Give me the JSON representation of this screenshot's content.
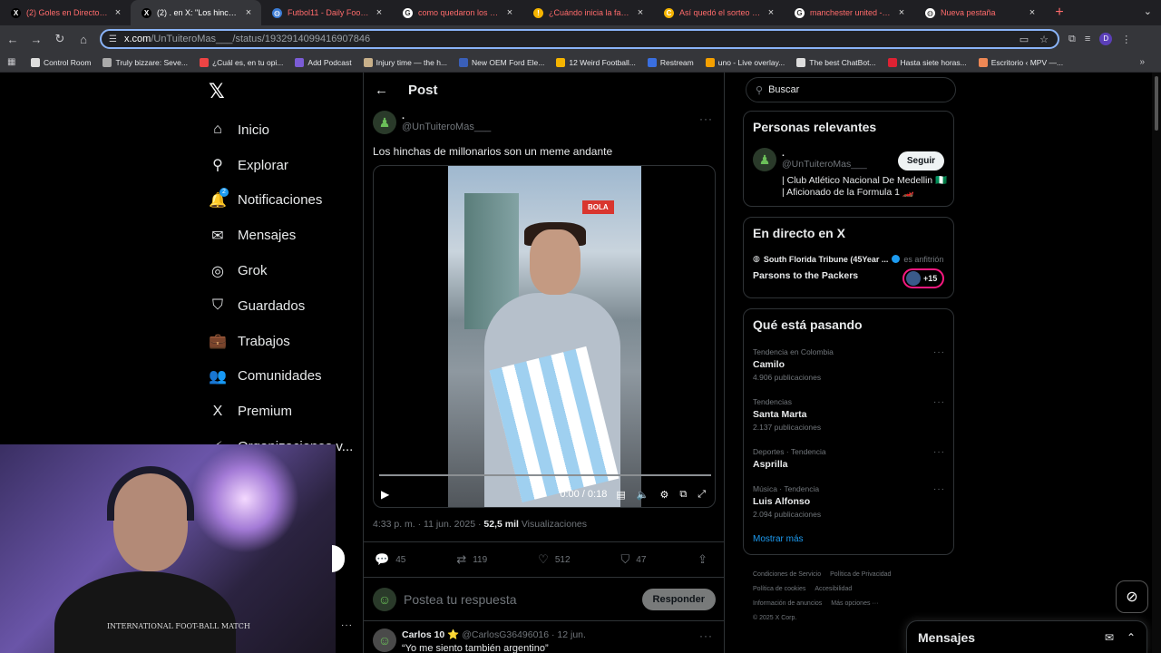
{
  "browser": {
    "tabs": [
      {
        "title": "(2) Goles en Directo (@y...",
        "fav_color": "#000",
        "fav_glyph": "X"
      },
      {
        "title": "(2) . en X: \"Los hinchas d...",
        "fav_color": "#000",
        "fav_glyph": "X",
        "active": true
      },
      {
        "title": "Futbol11 - Daily Football...",
        "fav_color": "#3a7bd5",
        "fav_glyph": "◍"
      },
      {
        "title": "como quedaron los grupo...",
        "fav_color": "#fff",
        "fav_glyph": "G"
      },
      {
        "title": "¿Cuándo inicia la fase de...",
        "fav_color": "#f5b400",
        "fav_glyph": "!"
      },
      {
        "title": "Así quedó el sorteo de...",
        "fav_color": "#f5b400",
        "fav_glyph": "C"
      },
      {
        "title": "manchester united - Bus...",
        "fav_color": "#fff",
        "fav_glyph": "G"
      },
      {
        "title": "Nueva pestaña",
        "fav_color": "#fff",
        "fav_glyph": "◍"
      }
    ],
    "new_tab": "+",
    "url_host": "x.com",
    "url_path": "/UnTuiteroMas___/status/1932914099416907846",
    "bookmarks": [
      {
        "label": "Control Room",
        "color": "#ddd"
      },
      {
        "label": "Truly bizzare: Seve...",
        "color": "#aaa"
      },
      {
        "label": "¿Cuál es, en tu opi...",
        "color": "#e44"
      },
      {
        "label": "Add Podcast",
        "color": "#7b5cd6"
      },
      {
        "label": "Injury time — the h...",
        "color": "#c8b08a"
      },
      {
        "label": "New OEM Ford Ele...",
        "color": "#3a5fb8"
      },
      {
        "label": "12 Weird Football...",
        "color": "#f5b400"
      },
      {
        "label": "Restream",
        "color": "#3a6fe0"
      },
      {
        "label": "uno - Live overlay...",
        "color": "#f5a000"
      },
      {
        "label": "The best ChatBot...",
        "color": "#ddd"
      },
      {
        "label": "Hasta siete horas...",
        "color": "#d23"
      },
      {
        "label": "Escritorio ‹ MPV —...",
        "color": "#e85"
      }
    ]
  },
  "nav": {
    "items": [
      {
        "label": "Inicio",
        "icon": "⌂",
        "name": "home"
      },
      {
        "label": "Explorar",
        "icon": "⚲",
        "name": "explore"
      },
      {
        "label": "Notificaciones",
        "icon": "🔔",
        "name": "notifications",
        "badge": "2"
      },
      {
        "label": "Mensajes",
        "icon": "✉",
        "name": "messages"
      },
      {
        "label": "Grok",
        "icon": "◎",
        "name": "grok"
      },
      {
        "label": "Guardados",
        "icon": "⛉",
        "name": "bookmarks"
      },
      {
        "label": "Trabajos",
        "icon": "💼",
        "name": "jobs"
      },
      {
        "label": "Comunidades",
        "icon": "👥",
        "name": "communities"
      },
      {
        "label": "Premium",
        "icon": "X",
        "name": "premium"
      },
      {
        "label": "Organizaciones v...",
        "icon": "⚡",
        "name": "organizations"
      }
    ]
  },
  "post": {
    "header": "Post",
    "author_name": ".",
    "author_handle": "@UnTuiteroMas___",
    "text": "Los hinchas de millonarios son un meme andante",
    "video_logo": "BOLA",
    "video_time": "0:00 / 0:18",
    "progress": 0,
    "timestamp": "4:33 p. m. · 11 jun. 2025 · ",
    "views_count": "52,5 mil",
    "views_label": " Visualizaciones",
    "replies": "45",
    "reposts": "119",
    "likes": "512",
    "bookmarks": "47",
    "reply_placeholder": "Postea tu respuesta",
    "reply_button": "Responder"
  },
  "first_reply": {
    "name": "Carlos 10 ⭐",
    "handle": "@CarlosG36496016 · 12 jun.",
    "text": "“Yo me siento también argentino”"
  },
  "sidebar": {
    "search_placeholder": "Buscar",
    "relevant_title": "Personas relevantes",
    "relevant": {
      "name": ".",
      "handle": "@UnTuiteroMas___",
      "bio": "| Club Atlético Nacional De Medellin 🇳🇬 | Aficionado de la Formula 1 🏎️",
      "follow": "Seguir"
    },
    "live_title": "En directo en X",
    "live": {
      "host": "South Florida Tribune (45Year ...",
      "role": "es anfitrión",
      "title": "Parsons to the Packers",
      "count": "+15"
    },
    "trends_title": "Qué está pasando",
    "trends": [
      {
        "cat": "Tendencia en Colombia",
        "name": "Camilo",
        "count": "4.906 publicaciones"
      },
      {
        "cat": "Tendencias",
        "name": "Santa Marta",
        "count": "2.137 publicaciones"
      },
      {
        "cat": "Deportes · Tendencia",
        "name": "Asprilla",
        "count": ""
      },
      {
        "cat": "Música · Tendencia",
        "name": "Luis Alfonso",
        "count": "2.094 publicaciones"
      }
    ],
    "show_more": "Mostrar más",
    "footer": [
      "Condiciones de Servicio",
      "Política de Privacidad",
      "Política de cookies",
      "Accesibilidad",
      "Información de anuncios",
      "Más opciones ···",
      "© 2025 X Corp."
    ]
  },
  "messages_drawer": {
    "title": "Mensajes"
  },
  "webcam": {
    "shirt_text": "INTERNATIONAL FOOT-BALL MATCH"
  }
}
